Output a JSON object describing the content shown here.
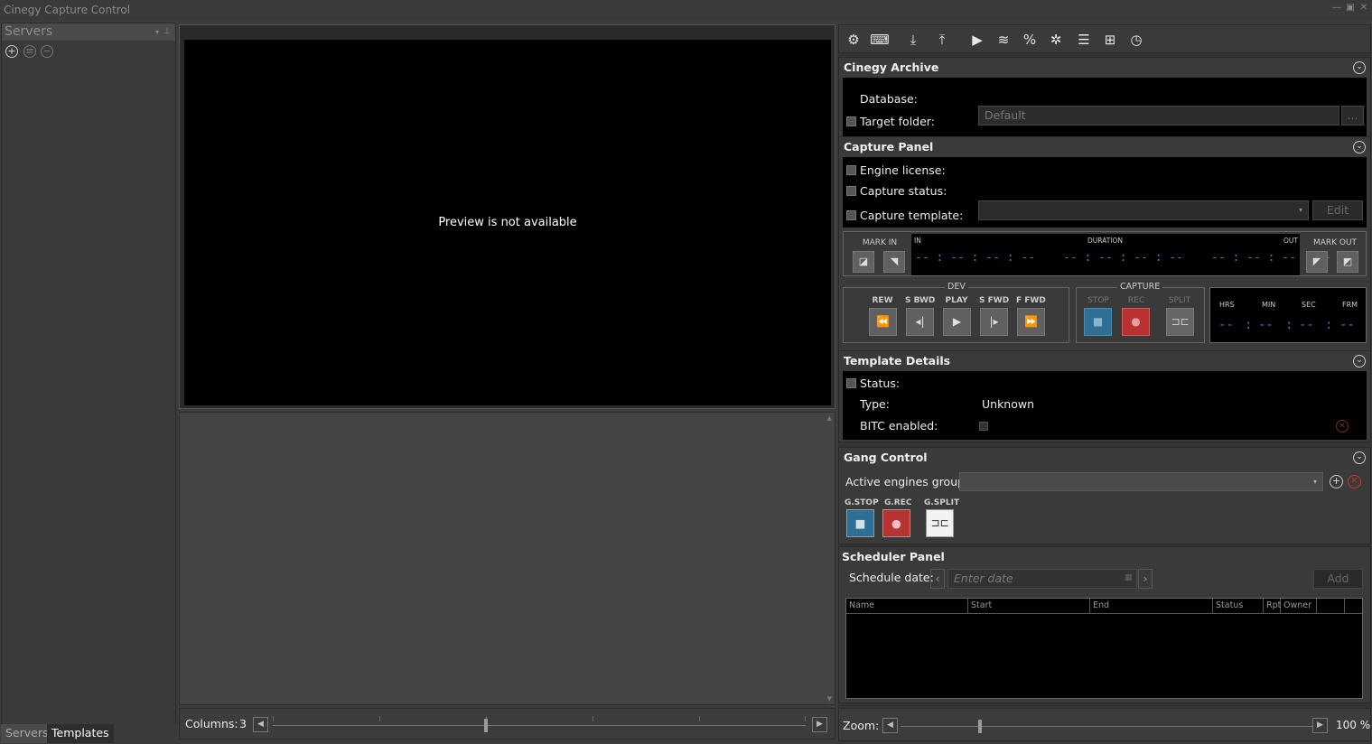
{
  "window": {
    "title": "Cinegy Capture Control"
  },
  "servers": {
    "title": "Servers",
    "tabs": [
      "Servers",
      "Templates"
    ]
  },
  "preview": {
    "message": "Preview is not available"
  },
  "columns": {
    "label": "Columns:",
    "value": "3",
    "slider_fraction": 0.4
  },
  "archive": {
    "title": "Cinegy Archive",
    "database_label": "Database:",
    "target_folder_label": "Target folder:",
    "target_folder_placeholder": "Default",
    "browse_label": "..."
  },
  "capture": {
    "title": "Capture Panel",
    "engine_license_label": "Engine license:",
    "capture_status_label": "Capture status:",
    "capture_template_label": "Capture template:",
    "edit_label": "Edit",
    "mark_in_label": "MARK IN",
    "mark_out_label": "MARK OUT",
    "in_label": "IN",
    "duration_label": "DURATION",
    "out_label": "OUT",
    "in_tc": "-- : -- : -- : --",
    "duration_tc": "-- : -- : -- : --",
    "out_tc": "-- : -- : -- : --",
    "dev_label": "DEV",
    "dev_buttons": [
      "REW",
      "S BWD",
      "PLAY",
      "S FWD",
      "F FWD"
    ],
    "capture_group_label": "CAPTURE",
    "capture_buttons": [
      "STOP",
      "REC",
      "SPLIT"
    ],
    "tc_labels": [
      "HRS",
      "MIN",
      "SEC",
      "FRM"
    ],
    "tc_values": [
      "--",
      ":",
      "--",
      ":",
      "--",
      ":",
      "--"
    ]
  },
  "template_details": {
    "title": "Template Details",
    "status_label": "Status:",
    "type_label": "Type:",
    "type_value": "Unknown",
    "bitc_label": "BITC enabled:"
  },
  "gang": {
    "title": "Gang Control",
    "active_group_label": "Active engines group:",
    "buttons": [
      "G.STOP",
      "G.REC",
      "G.SPLIT"
    ]
  },
  "scheduler": {
    "title": "Scheduler Panel",
    "date_label": "Schedule date:",
    "date_placeholder": "Enter date",
    "add_label": "Add",
    "columns": [
      "Name",
      "Start",
      "End",
      "Status",
      "Rpt",
      "Owner"
    ]
  },
  "zoom": {
    "label": "Zoom:",
    "value": "100 %",
    "slider_fraction": 0.19
  },
  "colors": {
    "stop": "#2f6f95",
    "rec": "#b83232",
    "timecode": "#3d7fae"
  }
}
